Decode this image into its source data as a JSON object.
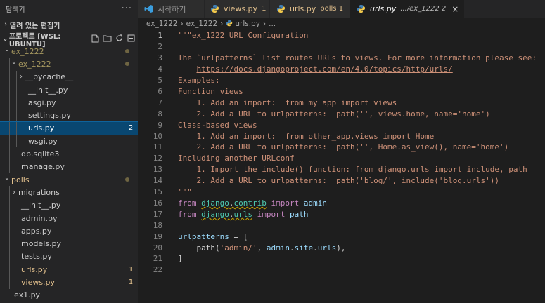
{
  "sidebar": {
    "title": "탐색기",
    "more": "···",
    "open_editors": "열려 있는 편집기",
    "project": "프로젝트 [WSL: UBUNTU]",
    "tree": [
      {
        "label": "ex_1222",
        "kind": "folder-open",
        "depth": 0,
        "dot": true
      },
      {
        "label": "ex_1222",
        "kind": "folder-open",
        "depth": 1,
        "dot": true
      },
      {
        "label": "__pycache__",
        "kind": "folder",
        "depth": 2
      },
      {
        "label": "__init__.py",
        "kind": "py",
        "depth": 2
      },
      {
        "label": "asgi.py",
        "kind": "py",
        "depth": 2
      },
      {
        "label": "settings.py",
        "kind": "py",
        "depth": 2
      },
      {
        "label": "urls.py",
        "kind": "py",
        "depth": 2,
        "badge": "2",
        "selected": true
      },
      {
        "label": "wsgi.py",
        "kind": "py",
        "depth": 2
      },
      {
        "label": "db.sqlite3",
        "kind": "db",
        "depth": 1
      },
      {
        "label": "manage.py",
        "kind": "py",
        "depth": 1
      },
      {
        "label": "polls",
        "kind": "folder-open",
        "depth": 0,
        "modified": true,
        "dot": true
      },
      {
        "label": "migrations",
        "kind": "folder",
        "depth": 1
      },
      {
        "label": "__init__.py",
        "kind": "py",
        "depth": 1
      },
      {
        "label": "admin.py",
        "kind": "py",
        "depth": 1
      },
      {
        "label": "apps.py",
        "kind": "py",
        "depth": 1
      },
      {
        "label": "models.py",
        "kind": "py",
        "depth": 1
      },
      {
        "label": "tests.py",
        "kind": "py",
        "depth": 1
      },
      {
        "label": "urls.py",
        "kind": "py",
        "depth": 1,
        "badge": "1",
        "modified": true
      },
      {
        "label": "views.py",
        "kind": "py",
        "depth": 1,
        "badge": "1",
        "modified": true
      },
      {
        "label": "ex1.py",
        "kind": "py",
        "depth": 0
      }
    ]
  },
  "tabs": [
    {
      "label": "시작하기",
      "icon": "vscode-icon",
      "sub": "",
      "active": false
    },
    {
      "label": "views.py",
      "icon": "python-icon",
      "sub": "1",
      "active": false
    },
    {
      "label": "urls.py",
      "icon": "python-icon",
      "sub": "polls 1",
      "active": false
    },
    {
      "label": "urls.py",
      "icon": "python-icon",
      "sub": ".../ex_1222 2",
      "active": true,
      "close": "×"
    }
  ],
  "breadcrumbs": [
    "ex_1222",
    "ex_1222",
    "urls.py",
    "..."
  ],
  "editor": {
    "current_line": 1,
    "lines": [
      "\"\"\"ex_1222 URL Configuration",
      "",
      "The `urlpatterns` list routes URLs to views. For more information please see:",
      "    https://docs.djangoproject.com/en/4.0/topics/http/urls/",
      "Examples:",
      "Function views",
      "    1. Add an import:  from my_app import views",
      "    2. Add a URL to urlpatterns:  path('', views.home, name='home')",
      "Class-based views",
      "    1. Add an import:  from other_app.views import Home",
      "    2. Add a URL to urlpatterns:  path('', Home.as_view(), name='home')",
      "Including another URLconf",
      "    1. Import the include() function: from django.urls import include, path",
      "    2. Add a URL to urlpatterns:  path('blog/', include('blog.urls'))",
      "\"\"\"",
      "from django.contrib import admin",
      "from django.urls import path",
      "",
      "urlpatterns = [",
      "    path('admin/', admin.site.urls),",
      "]",
      ""
    ]
  },
  "colors": {
    "sidebar_bg": "#252526",
    "editor_bg": "#1e1e1e",
    "selection": "#094771",
    "string": "#ce9178",
    "keyword": "#c586c0",
    "module": "#4ec9b0",
    "variable": "#9cdcfe",
    "modified": "#e2c08d"
  }
}
